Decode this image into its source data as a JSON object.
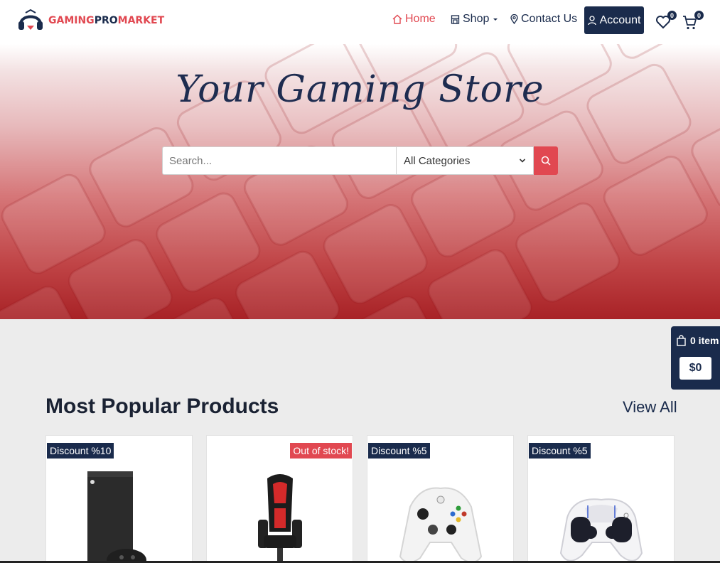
{
  "brand": {
    "part_a": "GAMING",
    "part_b": "PRO",
    "part_c": "MARKET"
  },
  "nav": {
    "home": "Home",
    "shop": "Shop",
    "contact": "Contact Us",
    "account": "Account",
    "wishlist_count": "0",
    "cart_count": "0"
  },
  "hero": {
    "title": "Your Gaming Store",
    "search_placeholder": "Search...",
    "category_selected": "All Categories"
  },
  "floating_cart": {
    "items": "0 item",
    "total": "$0"
  },
  "section": {
    "title": "Most Popular Products",
    "view_all": "View All"
  },
  "products": [
    {
      "tag": "Discount %10",
      "tag_type": "discount",
      "icon": "xbox-console"
    },
    {
      "tag": "Out of stock!",
      "tag_type": "out-of-stock",
      "icon": "gaming-chair"
    },
    {
      "tag": "Discount %5",
      "tag_type": "discount",
      "icon": "xbox-controller"
    },
    {
      "tag": "Discount %5",
      "tag_type": "discount",
      "icon": "ps5-controller"
    }
  ],
  "colors": {
    "navy": "#1a2b4c",
    "accent": "#e14851",
    "background": "#ececec"
  }
}
